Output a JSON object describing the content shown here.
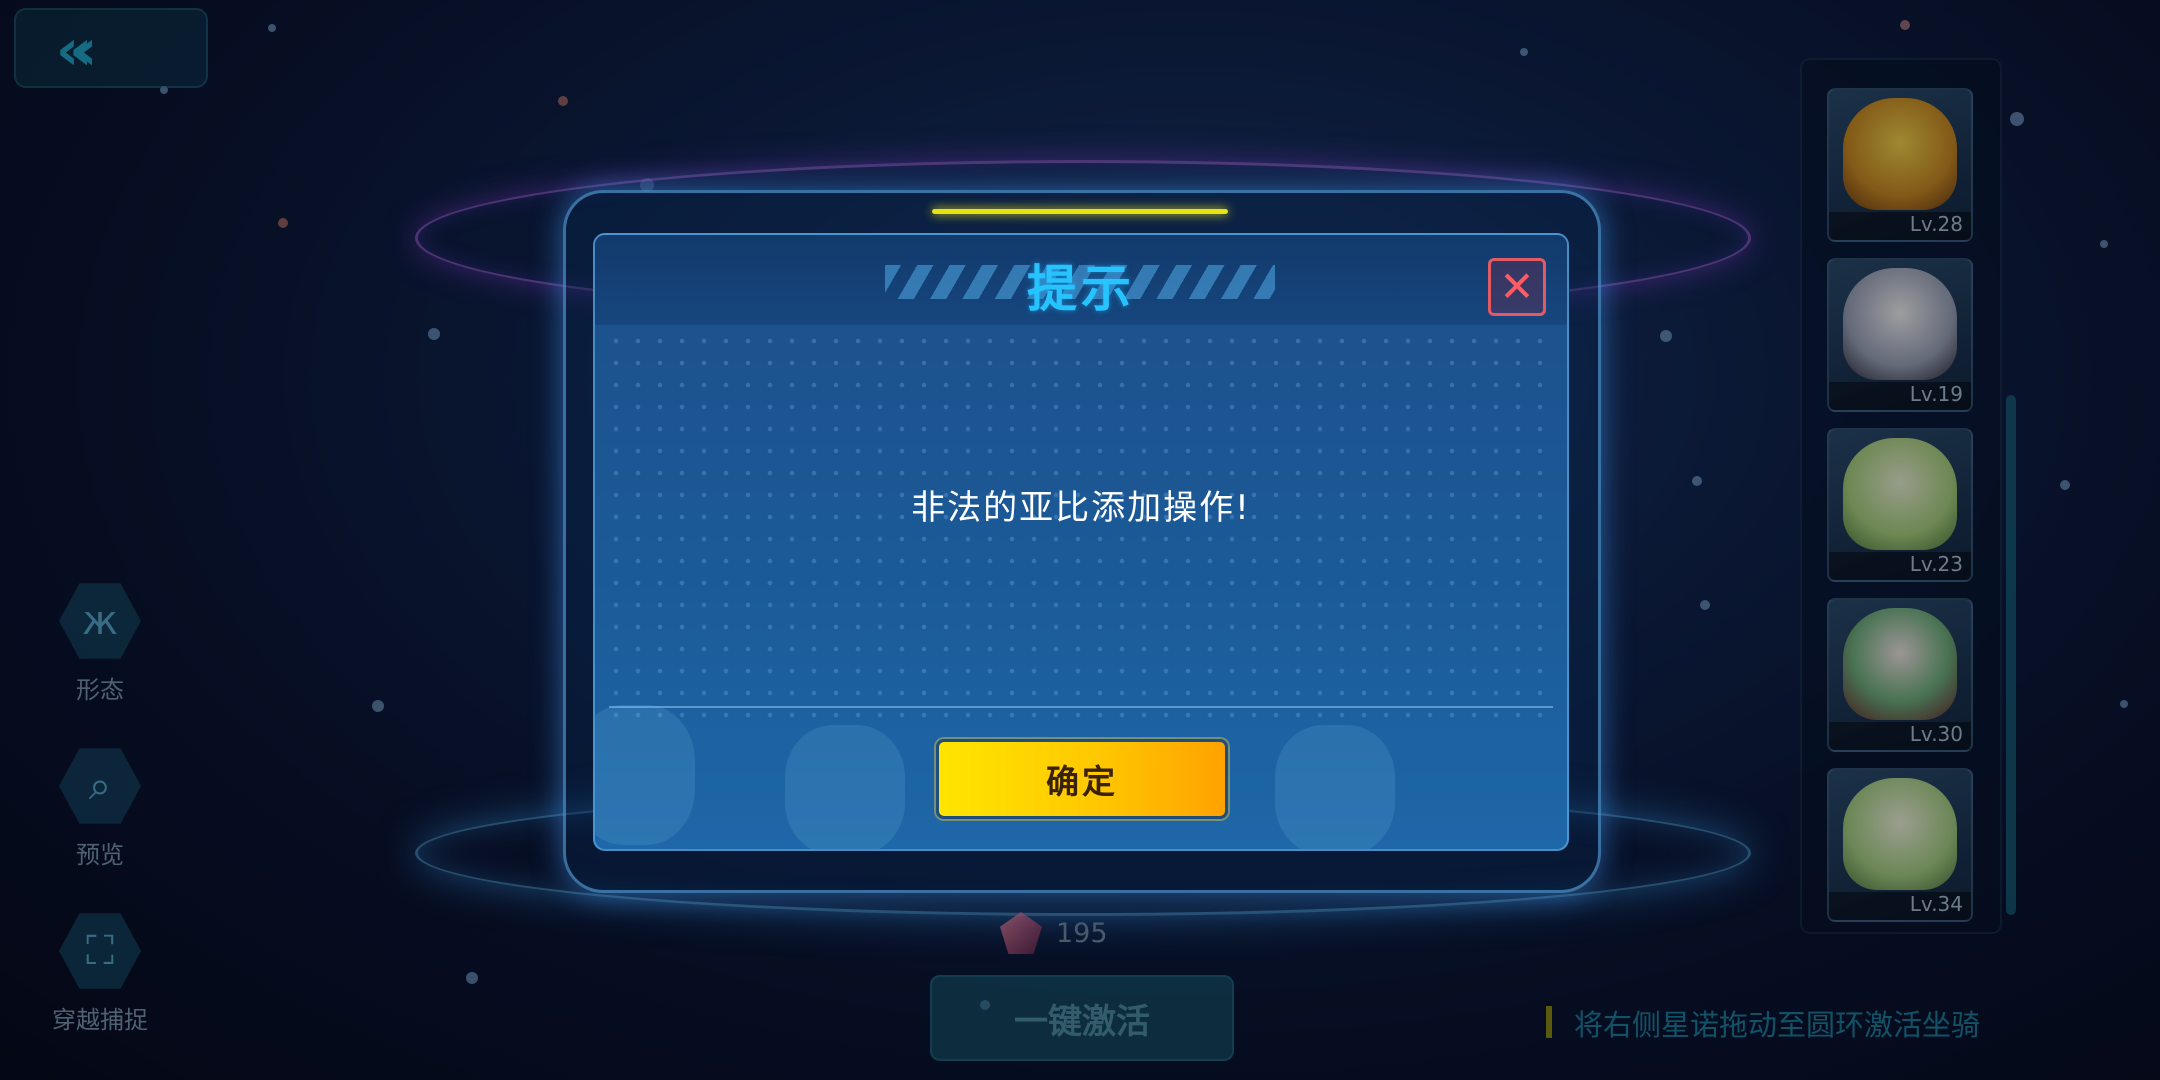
{
  "app": {
    "back_icon": "double-chevron-left-icon"
  },
  "left_tools": [
    {
      "label": "形态",
      "icon": "butterfly-icon"
    },
    {
      "label": "预览",
      "icon": "search-icon"
    },
    {
      "label": "穿越捕捉",
      "icon": "scan-frame-icon"
    }
  ],
  "pets": [
    {
      "level": "Lv.28"
    },
    {
      "level": "Lv.19"
    },
    {
      "level": "Lv.23"
    },
    {
      "level": "Lv.30"
    },
    {
      "level": "Lv.34"
    }
  ],
  "bottom": {
    "cost_value": "195",
    "cost_icon": "gem-icon",
    "activate_label": "一键激活",
    "hint_text": "将右侧星诺拖动至圆环激活坐骑"
  },
  "dialog": {
    "title": "提示",
    "message": "非法的亚比添加操作!",
    "confirm_label": "确定",
    "close_icon": "close-icon"
  },
  "colors": {
    "title": "#27c3ff",
    "confirm_start": "#ffe500",
    "confirm_end": "#ffa200",
    "close_border": "#e25a64",
    "accent_line": "#e6e214"
  }
}
